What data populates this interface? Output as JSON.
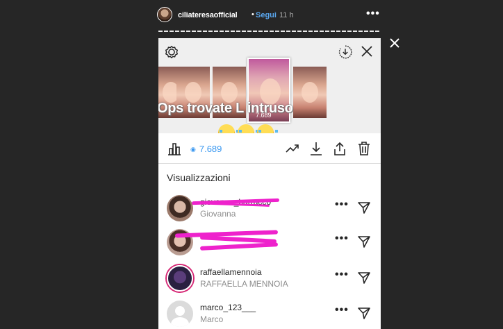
{
  "story": {
    "username": "ciliateresaofficial",
    "separator": "•",
    "follow_label": "Segui",
    "time_ago": "11 h",
    "more_label": "•••"
  },
  "preview": {
    "overlay_text": "Ops trovate L intruso",
    "thumb_view_count": "7.689"
  },
  "action_bar": {
    "views_count": "7.689"
  },
  "viewers_section": {
    "title": "Visualizzazioni",
    "viewers": [
      {
        "username": "giovanna_barracco",
        "full_name": "Giovanna",
        "more": "•••"
      },
      {
        "username": "",
        "full_name": "",
        "more": "•••"
      },
      {
        "username": "raffaellamennoia",
        "full_name": "RAFFAELLA MENNOIA",
        "more": "•••"
      },
      {
        "username": "marco_123___",
        "full_name": "Marco",
        "more": "•••"
      }
    ]
  },
  "colors": {
    "background": "#262626",
    "link_blue": "#3897f0",
    "follow_blue": "#5aa8f0",
    "redaction_pink": "#ee22cc"
  },
  "icons": [
    "settings-icon",
    "archive-download-icon",
    "close-icon",
    "insights-chart-icon",
    "eye-icon",
    "trending-icon",
    "download-icon",
    "share-icon",
    "trash-icon",
    "more-icon",
    "send-icon"
  ]
}
